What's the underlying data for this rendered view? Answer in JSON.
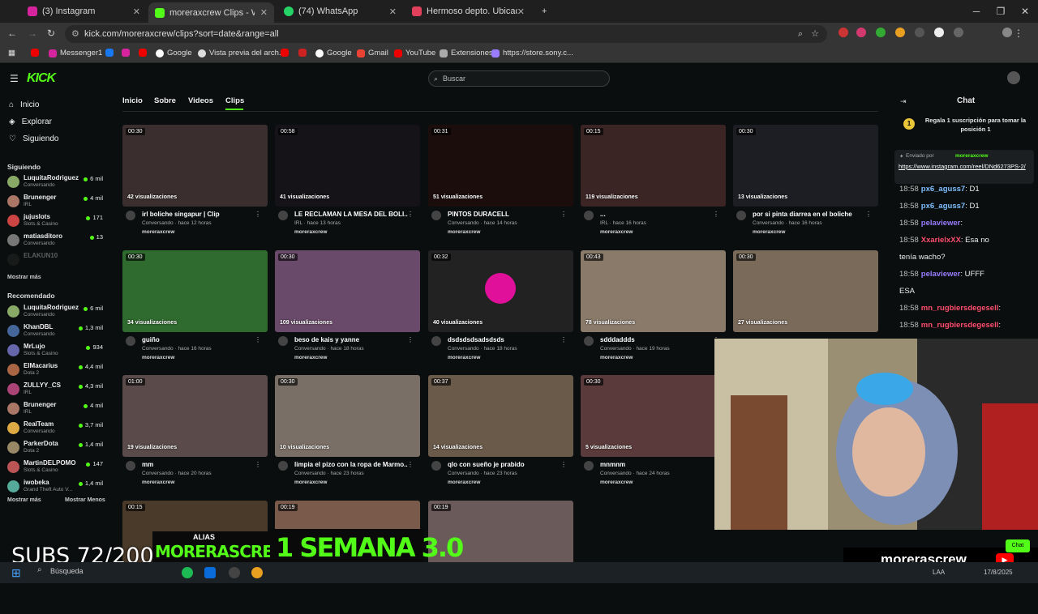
{
  "browser": {
    "tabs": [
      {
        "label": "(3) Instagram",
        "color": "#d6249f"
      },
      {
        "label": "moreraxcrew Clips - Watch",
        "color": "#53fc18"
      },
      {
        "label": "(74) WhatsApp",
        "color": "#25d366"
      },
      {
        "label": "Hermoso depto. Ubicación úni",
        "color": "#e0405a"
      }
    ],
    "url": "kick.com/moreraxcrew/clips?sort=date&range=all",
    "bookmarks": [
      "Messenger1",
      "Google",
      "Vista previa del arch...",
      "Google",
      "Gmail",
      "YouTube",
      "Extensiones",
      "https://store.sony.c..."
    ]
  },
  "header": {
    "logo": "KICK",
    "search_placeholder": "Buscar"
  },
  "sidebar": {
    "nav": [
      "Inicio",
      "Explorar",
      "Siguiendo"
    ],
    "following_title": "Siguiendo",
    "following": [
      {
        "name": "LuquitaRodriguez",
        "cat": "Conversando",
        "viewers": "6 mil",
        "color": "#8a6"
      },
      {
        "name": "Brunenger",
        "cat": "IRL",
        "viewers": "4 mil",
        "color": "#a76"
      },
      {
        "name": "jujuslots",
        "cat": "Slots & Casino",
        "viewers": "171",
        "color": "#c44"
      },
      {
        "name": "matiasditoro",
        "cat": "Conversando",
        "viewers": "13",
        "color": "#777"
      },
      {
        "name": "ELAKUN10",
        "cat": "",
        "viewers": "",
        "color": "#333"
      }
    ],
    "show_more": "Mostrar más",
    "recommended_title": "Recomendado",
    "recommended": [
      {
        "name": "LuquitaRodriguez",
        "cat": "Conversando",
        "viewers": "6 mil",
        "color": "#8a6"
      },
      {
        "name": "KhanDBL",
        "cat": "Conversando",
        "viewers": "1,3 mil",
        "color": "#469"
      },
      {
        "name": "MrLujo",
        "cat": "Slots & Casino",
        "viewers": "934",
        "color": "#66a"
      },
      {
        "name": "ElMacarius",
        "cat": "Dota 2",
        "viewers": "4,4 mil",
        "color": "#a64"
      },
      {
        "name": "ZULLYY_CS",
        "cat": "IRL",
        "viewers": "4,3 mil",
        "color": "#a47"
      },
      {
        "name": "Brunenger",
        "cat": "IRL",
        "viewers": "4 mil",
        "color": "#a76"
      },
      {
        "name": "RealTeam",
        "cat": "Conversando",
        "viewers": "3,7 mil",
        "color": "#da4"
      },
      {
        "name": "ParkerDota",
        "cat": "Dota 2",
        "viewers": "1,4 mil",
        "color": "#986"
      },
      {
        "name": "MartinDELPOMO",
        "cat": "Slots & Casino",
        "viewers": "147",
        "color": "#b55"
      },
      {
        "name": "iwobeka",
        "cat": "Grand Theft Auto V...",
        "viewers": "1,4 mil",
        "color": "#5a9"
      }
    ],
    "show_more2": "Mostrar más",
    "show_less": "Mostrar Menos"
  },
  "channel_tabs": [
    "Inicio",
    "Sobre",
    "Videos",
    "Clips"
  ],
  "clips": [
    {
      "dur": "00:30",
      "views": "42 visualizaciones",
      "title": "irl boliche singapur | Clip",
      "meta": "Conversando · hace 12 horas",
      "bg": "#3a2e2e"
    },
    {
      "dur": "00:58",
      "views": "41 visualizaciones",
      "title": "LE RECLAMAN LA MESA DEL BOLI...",
      "meta": "IRL · hace 13 horas",
      "bg": "#151318"
    },
    {
      "dur": "00:31",
      "views": "51 visualizaciones",
      "title": "PINTOS DURACELL",
      "meta": "Conversando · hace 14 horas",
      "bg": "#1c0d0d"
    },
    {
      "dur": "00:15",
      "views": "119 visualizaciones",
      "title": "...",
      "meta": "IRL · hace 16 horas",
      "bg": "#3b2424"
    },
    {
      "dur": "00:30",
      "views": "13 visualizaciones",
      "title": "por si pinta diarrea en el boliche",
      "meta": "Conversando · hace 16 horas",
      "bg": "#1d1e24"
    },
    {
      "dur": "00:30",
      "views": "34 visualizaciones",
      "title": "guiño",
      "meta": "Conversando · hace 16 horas",
      "bg": "#2f6b2f"
    },
    {
      "dur": "00:30",
      "views": "109 visualizaciones",
      "title": "beso de kais y yanne",
      "meta": "Conversando · hace 18 horas",
      "bg": "#6a4a6a"
    },
    {
      "dur": "00:32",
      "views": "40 visualizaciones",
      "title": "dsdsdsdsadsdsds",
      "meta": "Conversando · hace 18 horas",
      "bg": "#222"
    },
    {
      "dur": "00:43",
      "views": "78 visualizaciones",
      "title": "sdddaddds",
      "meta": "Conversando · hace 19 horas",
      "bg": "#8a7a6a"
    },
    {
      "dur": "00:30",
      "views": "27 visualizaciones",
      "title": "",
      "meta": "",
      "bg": "#7a6a5a"
    },
    {
      "dur": "01:00",
      "views": "19 visualizaciones",
      "title": "mm",
      "meta": "Conversando · hace 20 horas",
      "bg": "#5a4a4a"
    },
    {
      "dur": "00:30",
      "views": "10 visualizaciones",
      "title": "limpia el pizo con la ropa de Marmo...",
      "meta": "Conversando · hace 23 horas",
      "bg": "#7a6f66"
    },
    {
      "dur": "00:37",
      "views": "14 visualizaciones",
      "title": "qlo con sueño je prabido",
      "meta": "Conversando · hace 23 horas",
      "bg": "#6a5a4a"
    },
    {
      "dur": "00:30",
      "views": "5 visualizaciones",
      "title": "mnmnm",
      "meta": "Conversando · hace 24 horas",
      "bg": "#5a3a3a"
    },
    {
      "dur": "00:15",
      "views": "",
      "title": "",
      "meta": "",
      "bg": "#3a7a3a"
    },
    {
      "dur": "00:15",
      "views": "",
      "title": "",
      "meta": "",
      "bg": "#4a3a2a"
    },
    {
      "dur": "00:19",
      "views": "",
      "title": "",
      "meta": "",
      "bg": "#7a5a4a"
    },
    {
      "dur": "00:19",
      "views": "",
      "title": "",
      "meta": "",
      "bg": "#6a5a5a"
    }
  ],
  "clip_owner": "moreraxcrew",
  "chat": {
    "title": "Chat",
    "gift_text": "Regala 1 suscripción para tomar la posición 1",
    "pinned_by": "Enviado por",
    "pinned_user": "moreraxcrew",
    "pinned_link": "https://www.instagram.com/reel/DNd6273PS-2/",
    "messages": [
      {
        "time": "18:58",
        "user": "px6_aguss7",
        "text": ": D1",
        "color": "#7fbfff"
      },
      {
        "time": "18:58",
        "user": "px6_aguss7",
        "text": ": D1",
        "color": "#7fbfff"
      },
      {
        "time": "18:58",
        "user": "pelaviewer",
        "text": ":",
        "color": "#9a7dff"
      },
      {
        "time": "18:58",
        "user": "XxarielxXX",
        "text": ": Esa no",
        "color": "#ff4d6d"
      },
      {
        "time": "",
        "user": "",
        "text": "tenía wacho?",
        "color": "#eee"
      },
      {
        "time": "18:58",
        "user": "pelaviewer",
        "text": ": UFFF",
        "color": "#9a7dff"
      },
      {
        "time": "",
        "user": "",
        "text": "ESA",
        "color": "#eee"
      },
      {
        "time": "18:58",
        "user": "mn_rugbiersdegesell",
        "text": ":",
        "color": "#ff4d6d"
      },
      {
        "time": "18:58",
        "user": "mn_rugbiersdegesell",
        "text": ":",
        "color": "#ff4d6d"
      },
      {
        "time": "18:58",
        "user": "mn_rugbiersdegesell",
        "text": ":",
        "color": "#ff4d6d"
      }
    ]
  },
  "overlay": {
    "subs": "SUBS  72/200",
    "alias_label": "ALIAS",
    "alias": "MORERASCREW",
    "promo": "1 SEMANA 3.0",
    "streamer": "morerascrew",
    "chat_button": "Chat"
  },
  "taskbar": {
    "search": "Búsqueda",
    "lang": "LAA",
    "date": "17/8/2025"
  }
}
